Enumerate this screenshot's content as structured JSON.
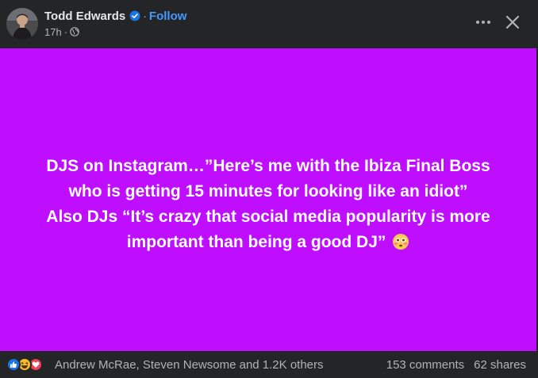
{
  "header": {
    "author_name": "Todd Edwards",
    "separator": "·",
    "follow_label": "Follow",
    "timestamp": "17h",
    "meta_separator": "·",
    "audience_icon": "globe-icon",
    "verified_icon": "verified-badge-icon",
    "more_icon": "more-horizontal-icon",
    "close_icon": "close-icon"
  },
  "post": {
    "background_color": "#bf0dff",
    "text_color": "#ffffff",
    "lines": [
      "DJS on Instagram…”Here’s me with the Ibiza Final Boss",
      "who is getting 15 minutes for looking like an idiot”",
      "Also DJs “It’s crazy that social media popularity is more",
      "important than being a good DJ”"
    ],
    "trailing_emoji": "flushed-face-emoji"
  },
  "footer": {
    "reactions": [
      "like-icon",
      "haha-icon",
      "love-icon"
    ],
    "reactors_text": "Andrew McRae, Steven Newsome and 1.2K others",
    "comments_text": "153 comments",
    "shares_text": "62 shares"
  },
  "colors": {
    "accent": "#4599ff",
    "background": "#242526",
    "muted_text": "#b0b3b8",
    "like": "#1b74e4",
    "haha": "#f7b928",
    "love": "#f33e58"
  }
}
